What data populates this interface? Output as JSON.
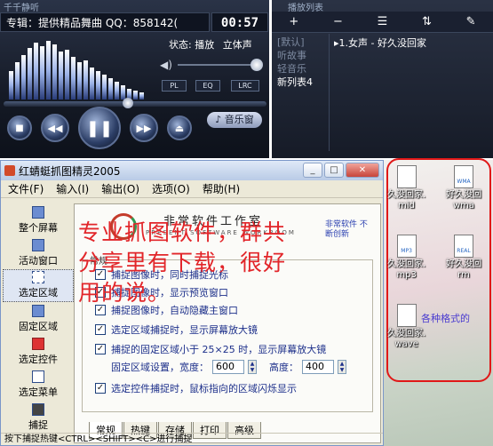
{
  "player": {
    "title": "千千静听",
    "track": "专辑：提供精品舞曲 QQ：858142(",
    "time": "00:57",
    "status_label": "状态: 播放",
    "channel": "立体声",
    "buttons": {
      "pl": "PL",
      "eq": "EQ",
      "lrc": "LRC"
    },
    "music_window": "音乐窗",
    "play_progress": 0.46,
    "volume": 0.95
  },
  "playlist": {
    "title": "播放列表",
    "toolbar": [
      "+",
      "−",
      "☰",
      "⇅",
      "✎"
    ],
    "categories": [
      {
        "label": "[默认]",
        "active": false
      },
      {
        "label": "听故事",
        "active": false
      },
      {
        "label": "轻音乐",
        "active": false
      },
      {
        "label": "新列表4",
        "active": true
      }
    ],
    "songs": [
      "▸1.女声 - 好久没回家"
    ]
  },
  "window": {
    "title": "红蜻蜓抓图精灵2005",
    "menu": [
      "文件(F)",
      "输入(I)",
      "输出(O)",
      "选项(O)",
      "帮助(H)"
    ],
    "sidebar": [
      "整个屏幕",
      "活动窗口",
      "选定区域",
      "固定区域",
      "选定控件",
      "选定菜单",
      "捕捉"
    ],
    "logo_title": "非常软件工作室",
    "logo_subtitle": "PRESENT SOFTWARE WORKROOM",
    "side_note": "非常软件 不断创新",
    "group_label": "常规",
    "options": [
      {
        "label": "捕捉图像时，同时捕捉光标",
        "checked": true
      },
      {
        "label": "捕捉图像时，显示预览窗口",
        "checked": true
      },
      {
        "label": "捕捉图像时，自动隐藏主窗口",
        "checked": true
      },
      {
        "label": "选定区域捕捉时，显示屏幕放大镜",
        "checked": true
      },
      {
        "label": "捕捉的固定区域小于 25×25 时，显示屏幕放大镜",
        "checked": true
      }
    ],
    "fixed_label": "固定区域设置，宽度：",
    "width_value": "600",
    "height_label": "高度：",
    "height_value": "400",
    "last_option": {
      "label": "选定控件捕捉时，鼠标指向的区域闪烁显示",
      "checked": true
    },
    "tabs": [
      "常规",
      "热键",
      "存储",
      "打印",
      "高级"
    ],
    "status": "按下捕捉热键<CTRL><SHIFT><C>进行捕捉"
  },
  "overlay_text": [
    "专业抓图软件，群共",
    "分享里有下载，很好",
    "用的说。"
  ],
  "desktop": {
    "icons": [
      {
        "glyph": "",
        "label": "久没回家.",
        "sub": "mid"
      },
      {
        "glyph": "WMA",
        "label": "好久没回",
        "sub": "wma"
      },
      {
        "glyph": "MP3",
        "label": "久没回家.",
        "sub": "mp3"
      },
      {
        "glyph": "REAL",
        "label": "好久没回",
        "sub": "rm"
      },
      {
        "glyph": "",
        "label": "久没回家.",
        "sub": "wave"
      }
    ],
    "caption": "各种格式的"
  }
}
